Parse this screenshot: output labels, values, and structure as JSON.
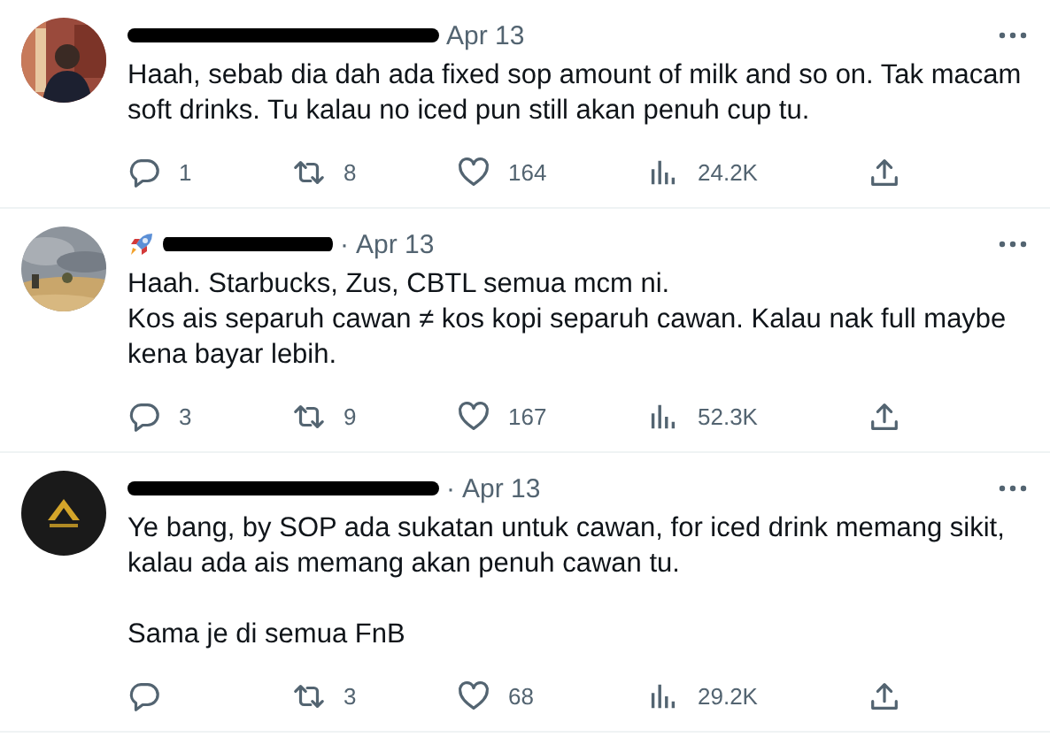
{
  "tweets": [
    {
      "kind": "plain",
      "avatar": {
        "kind": "person-photo"
      },
      "time": "Apr 13",
      "text": "Haah, sebab dia dah ada fixed sop amount of milk and so on. Tak macam soft drinks. Tu kalau no iced pun still akan penuh cup tu.",
      "stats": {
        "replies": "1",
        "retweets": "8",
        "likes": "164",
        "views": "24.2K"
      }
    },
    {
      "kind": "rocket-name",
      "avatar": {
        "kind": "landscape-photo"
      },
      "separator": "·",
      "time": "Apr 13",
      "text": "Haah. Starbucks, Zus, CBTL semua mcm ni.\nKos ais separuh cawan ≠ kos kopi separuh cawan. Kalau nak full maybe kena bayar lebih.",
      "stats": {
        "replies": "3",
        "retweets": "9",
        "likes": "167",
        "views": "52.3K"
      }
    },
    {
      "kind": "plain",
      "avatar": {
        "kind": "logo"
      },
      "separator": "·",
      "time": "Apr 13",
      "text": "Ye bang, by SOP ada sukatan untuk cawan, for iced drink memang sikit, kalau ada ais memang akan penuh cawan tu.\n\nSama je di semua FnB",
      "stats": {
        "retweets": "3",
        "likes": "68",
        "views": "29.2K"
      }
    }
  ]
}
